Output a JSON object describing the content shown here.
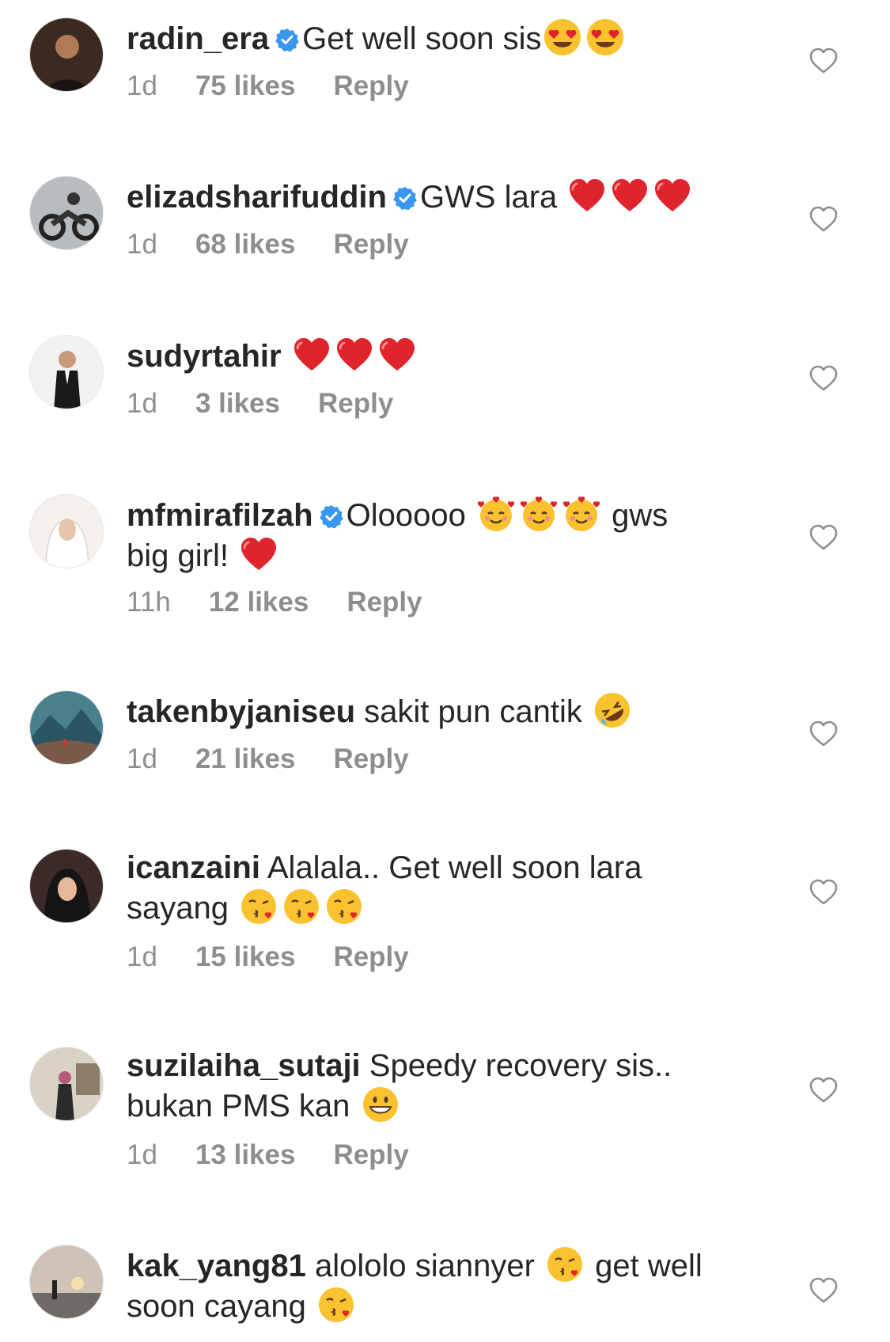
{
  "colors": {
    "text": "#262626",
    "meta": "#8e8e8e",
    "verified": "#3897f0",
    "heart_red": "#e0242c",
    "emoji_yellow": "#f9c22e"
  },
  "icons": {
    "like": "heart-outline-icon",
    "verified": "verified-badge-icon",
    "emoji_heart_eyes": "heart-eyes-emoji",
    "emoji_red_heart": "red-heart-emoji",
    "emoji_hearts_face": "smiling-face-with-hearts-emoji",
    "emoji_rofl": "rolling-laughing-emoji",
    "emoji_kiss": "face-blowing-kiss-emoji",
    "emoji_grin": "grinning-face-emoji"
  },
  "comments": [
    {
      "username": "radin_era",
      "verified": true,
      "text_parts": [
        "Get well soon sis"
      ],
      "text_line2": "",
      "time": "1d",
      "likes": "75 likes",
      "reply": "Reply"
    },
    {
      "username": "elizadsharifuddin",
      "verified": true,
      "text_parts": [
        "GWS lara "
      ],
      "text_line2": "",
      "time": "1d",
      "likes": "68 likes",
      "reply": "Reply"
    },
    {
      "username": "sudyrtahir",
      "verified": false,
      "text_parts": [
        ""
      ],
      "text_line2": "",
      "time": "1d",
      "likes": "3 likes",
      "reply": "Reply"
    },
    {
      "username": "mfmirafilzah",
      "verified": true,
      "text_parts": [
        "Olooooo ",
        " gws"
      ],
      "text_line2": "big girl! ",
      "time": "11h",
      "likes": "12 likes",
      "reply": "Reply"
    },
    {
      "username": "takenbyjaniseu",
      "verified": false,
      "text_parts": [
        "sakit pun cantik "
      ],
      "text_line2": "",
      "time": "1d",
      "likes": "21 likes",
      "reply": "Reply"
    },
    {
      "username": "icanzaini",
      "verified": false,
      "text_parts": [
        "Alalala.. Get well soon lara"
      ],
      "text_line2": "sayang ",
      "time": "1d",
      "likes": "15 likes",
      "reply": "Reply"
    },
    {
      "username": "suzilaiha_sutaji",
      "verified": false,
      "text_parts": [
        "Speedy recovery sis.."
      ],
      "text_line2": "bukan PMS kan ",
      "time": "1d",
      "likes": "13 likes",
      "reply": "Reply"
    },
    {
      "username": "kak_yang81",
      "verified": false,
      "text_parts": [
        "alololo siannyer ",
        " get well"
      ],
      "text_line2": "soon cayang ",
      "time": "",
      "likes": "",
      "reply": ""
    }
  ]
}
